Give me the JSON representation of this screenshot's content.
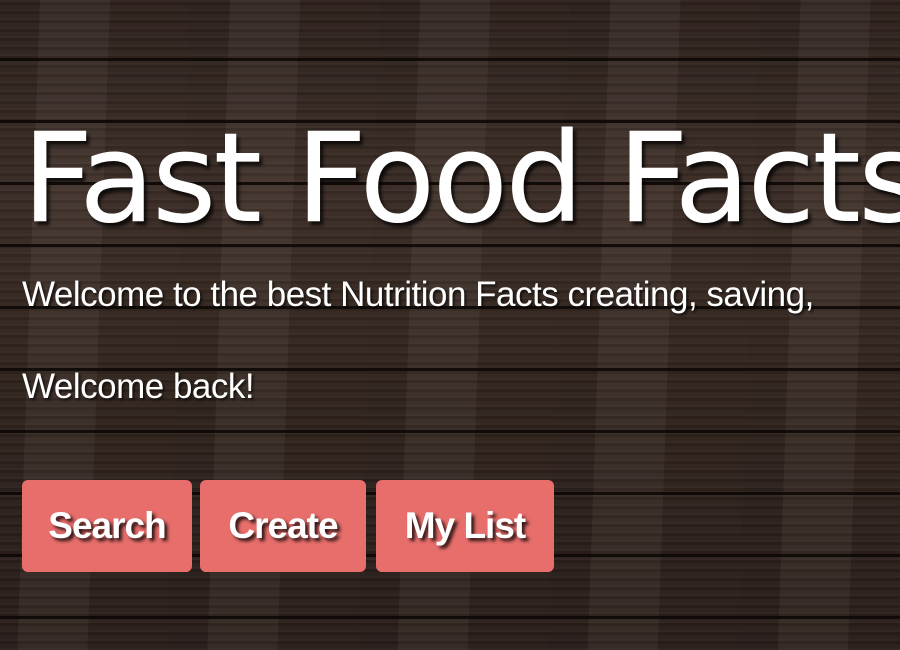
{
  "header": {
    "title": "Fast Food Facts",
    "tagline": "Welcome to the best Nutrition Facts creating, saving,",
    "welcome": "Welcome back!"
  },
  "nav": {
    "search_label": "Search",
    "create_label": "Create",
    "mylist_label": "My List"
  },
  "colors": {
    "button_bg": "#e76e6b",
    "text": "#ffffff",
    "background": "#3a2b24"
  }
}
